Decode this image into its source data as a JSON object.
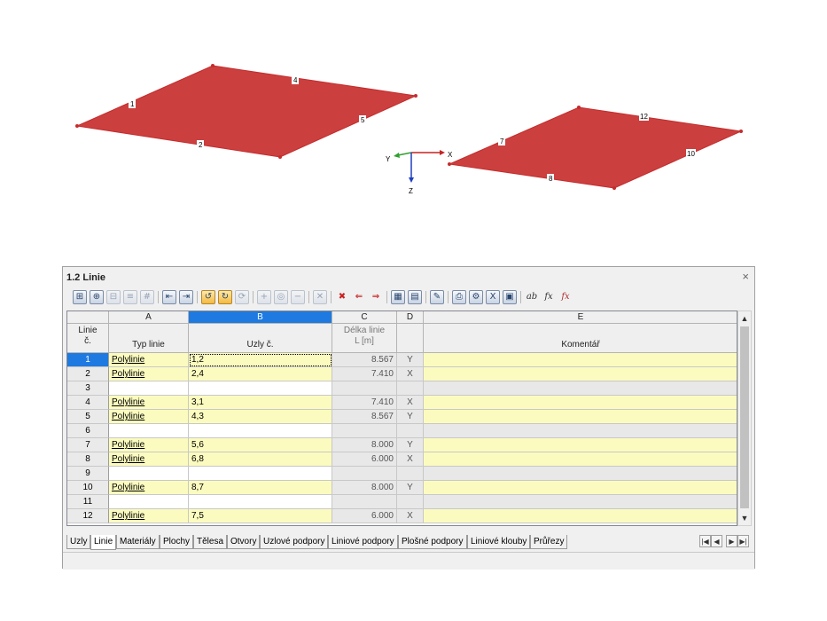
{
  "viewport": {
    "node_labels": [
      "1",
      "4",
      "5",
      "2",
      "12",
      "7",
      "10",
      "8"
    ],
    "axes": {
      "x": "X",
      "y": "Y",
      "z": "Z"
    },
    "plate_color": "#cc3f3f"
  },
  "panel": {
    "title": "1.2 Linie",
    "close_icon": "×",
    "columns": {
      "letters": [
        "A",
        "B",
        "C",
        "D",
        "E"
      ],
      "rownum_header_line1": "Linie",
      "rownum_header_line2": "č.",
      "col_a": "Typ linie",
      "col_b": "Uzly č.",
      "col_c_line1": "Délka linie",
      "col_c_line2": "L [m]",
      "col_e": "Komentář"
    },
    "rows": [
      {
        "num": "1",
        "type": "Polylinie",
        "nodes": "1,2",
        "length": "8.567",
        "dir": "Y",
        "comment": ""
      },
      {
        "num": "2",
        "type": "Polylinie",
        "nodes": "2,4",
        "length": "7.410",
        "dir": "X",
        "comment": ""
      },
      {
        "num": "3",
        "type": "",
        "nodes": "",
        "length": "",
        "dir": "",
        "comment": ""
      },
      {
        "num": "4",
        "type": "Polylinie",
        "nodes": "3,1",
        "length": "7.410",
        "dir": "X",
        "comment": ""
      },
      {
        "num": "5",
        "type": "Polylinie",
        "nodes": "4,3",
        "length": "8.567",
        "dir": "Y",
        "comment": ""
      },
      {
        "num": "6",
        "type": "",
        "nodes": "",
        "length": "",
        "dir": "",
        "comment": ""
      },
      {
        "num": "7",
        "type": "Polylinie",
        "nodes": "5,6",
        "length": "8.000",
        "dir": "Y",
        "comment": ""
      },
      {
        "num": "8",
        "type": "Polylinie",
        "nodes": "6,8",
        "length": "6.000",
        "dir": "X",
        "comment": ""
      },
      {
        "num": "9",
        "type": "",
        "nodes": "",
        "length": "",
        "dir": "",
        "comment": ""
      },
      {
        "num": "10",
        "type": "Polylinie",
        "nodes": "8,7",
        "length": "8.000",
        "dir": "Y",
        "comment": ""
      },
      {
        "num": "11",
        "type": "",
        "nodes": "",
        "length": "",
        "dir": "",
        "comment": ""
      },
      {
        "num": "12",
        "type": "Polylinie",
        "nodes": "7,5",
        "length": "6.000",
        "dir": "X",
        "comment": ""
      }
    ],
    "tabs": [
      "Uzly",
      "Linie",
      "Materiály",
      "Plochy",
      "Tělesa",
      "Otvory",
      "Uzlové podpory",
      "Liniové podpory",
      "Plošné podpory",
      "Liniové klouby",
      "Průřezy"
    ],
    "active_tab": "Linie",
    "colors": {
      "filled_row": "#fbfbbf",
      "gray_cell": "#e8e8e8",
      "selected": "#1e7ae0"
    }
  }
}
